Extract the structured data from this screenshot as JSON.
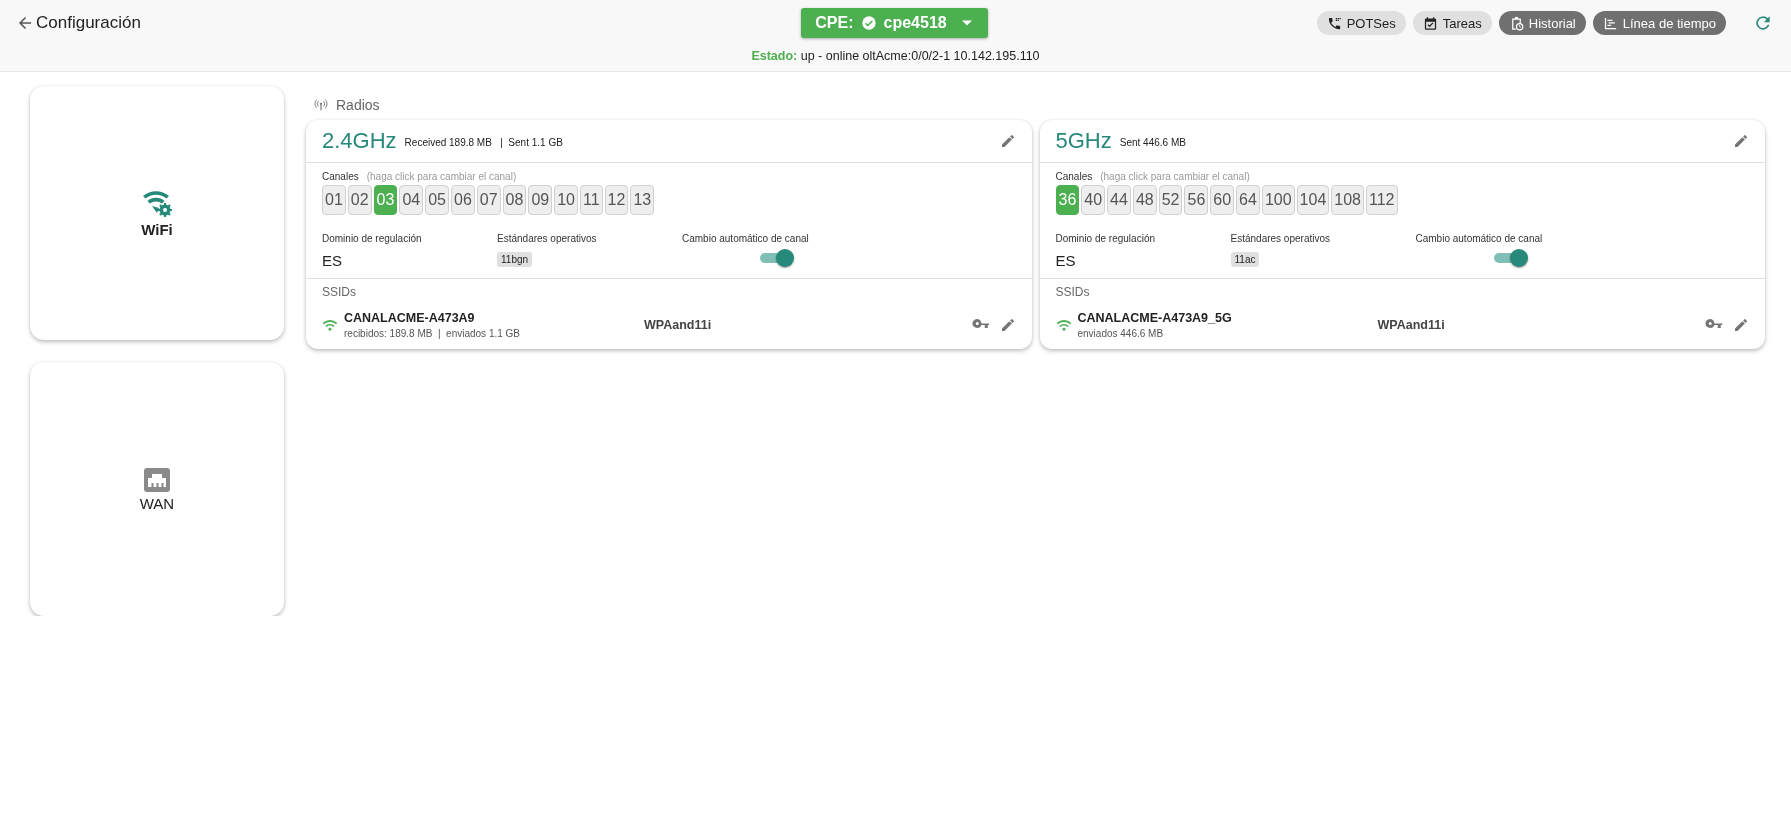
{
  "header": {
    "back_label": "Configuración",
    "cpe_prefix": "CPE:",
    "cpe_name": "cpe4518",
    "status_label": "Estado:",
    "status_text": "up - online oltAcme:0/0/2-1 10.142.195.110",
    "actions": [
      {
        "kind": "phone",
        "label": "POTSes",
        "highlighted": false
      },
      {
        "kind": "calendar",
        "label": "Tareas",
        "highlighted": false
      },
      {
        "kind": "history",
        "label": "Historial",
        "highlighted": true
      },
      {
        "kind": "timeline",
        "label": "Línea de tiempo",
        "highlighted": true
      }
    ]
  },
  "sidebar": {
    "items": [
      {
        "kind": "wifi",
        "label": "WiFi",
        "selected": true
      },
      {
        "kind": "wan",
        "label": "WAN",
        "selected": false
      }
    ]
  },
  "section_title": "Radios",
  "radios": [
    {
      "band": "2.4GHz",
      "stats": "Received 189.8 MB   |  Sent 1.1 GB",
      "channels_label": "Canales",
      "channels_hint": "(haga click para cambiar el canal)",
      "channels": [
        {
          "label": "01",
          "selected": false
        },
        {
          "label": "02",
          "selected": false
        },
        {
          "label": "03",
          "selected": true
        },
        {
          "label": "04",
          "selected": false
        },
        {
          "label": "05",
          "selected": false
        },
        {
          "label": "06",
          "selected": false
        },
        {
          "label": "07",
          "selected": false
        },
        {
          "label": "08",
          "selected": false
        },
        {
          "label": "09",
          "selected": false
        },
        {
          "label": "10",
          "selected": false
        },
        {
          "label": "11",
          "selected": false
        },
        {
          "label": "12",
          "selected": false
        },
        {
          "label": "13",
          "selected": false
        }
      ],
      "domain_label": "Dominio de regulación",
      "domain": "ES",
      "standards_label": "Estándares operativos",
      "standard": "11bgn",
      "auto_label": "Cambio automático de canal",
      "auto_channel": true,
      "ssids_label": "SSIDs",
      "ssids": [
        {
          "name": "CANALACME-A473A9",
          "traffic": "recibidos: 189.8 MB  |  enviados 1.1 GB",
          "security": "WPAand11i"
        }
      ]
    },
    {
      "band": "5GHz",
      "stats": "Sent 446.6 MB",
      "channels_label": "Canales",
      "channels_hint": "(haga click para cambiar el canal)",
      "channels": [
        {
          "label": "36",
          "selected": true
        },
        {
          "label": "40",
          "selected": false
        },
        {
          "label": "44",
          "selected": false
        },
        {
          "label": "48",
          "selected": false
        },
        {
          "label": "52",
          "selected": false
        },
        {
          "label": "56",
          "selected": false
        },
        {
          "label": "60",
          "selected": false
        },
        {
          "label": "64",
          "selected": false
        },
        {
          "label": "100",
          "selected": false
        },
        {
          "label": "104",
          "selected": false
        },
        {
          "label": "108",
          "selected": false
        },
        {
          "label": "112",
          "selected": false
        }
      ],
      "domain_label": "Dominio de regulación",
      "domain": "ES",
      "standards_label": "Estándares operativos",
      "standard": "11ac",
      "auto_label": "Cambio automático de canal",
      "auto_channel": true,
      "ssids_label": "SSIDs",
      "ssids": [
        {
          "name": "CANALACME-A473A9_5G",
          "traffic": "enviados 446.6 MB",
          "security": "WPAand11i"
        }
      ]
    }
  ]
}
